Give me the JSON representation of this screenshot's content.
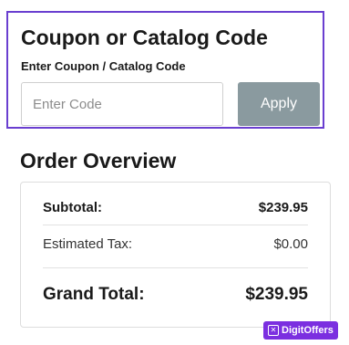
{
  "coupon": {
    "title": "Coupon or Catalog Code",
    "label": "Enter Coupon / Catalog Code",
    "input_placeholder": "Enter Code",
    "input_value": "",
    "apply_label": "Apply"
  },
  "overview": {
    "title": "Order Overview",
    "subtotal_label": "Subtotal:",
    "subtotal_value": "$239.95",
    "tax_label": "Estimated Tax:",
    "tax_value": "$0.00",
    "grand_total_label": "Grand Total:",
    "grand_total_value": "$239.95"
  },
  "watermark": {
    "text": "DigitOffers",
    "icon": "x-box-icon"
  },
  "colors": {
    "accent": "#6a3fd0",
    "apply_button": "#8a9a9f",
    "watermark": "#7b2fe0"
  }
}
